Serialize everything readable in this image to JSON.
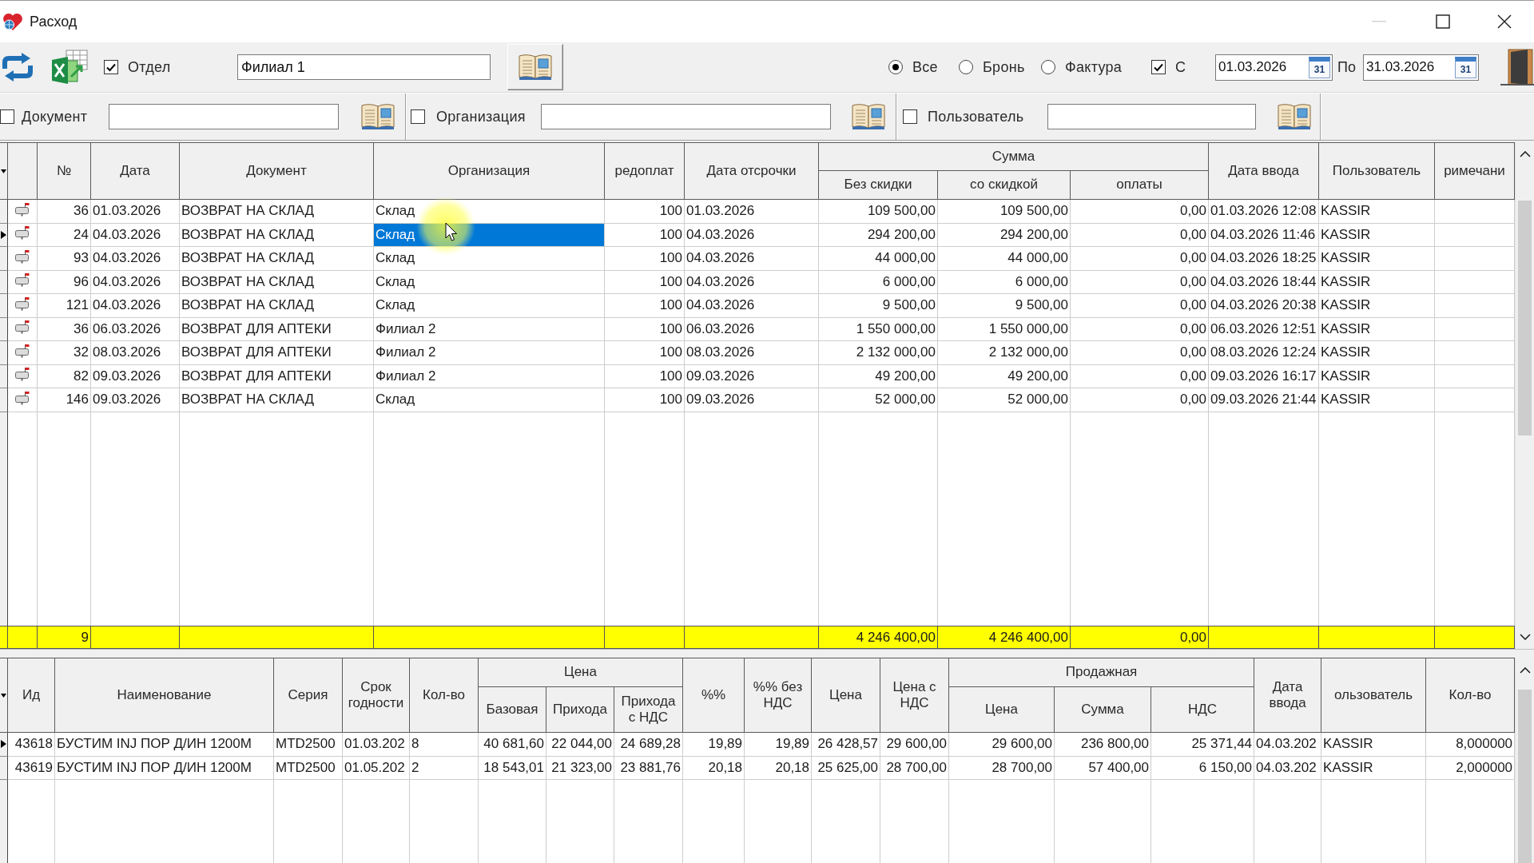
{
  "window": {
    "title": "Расход",
    "controls": [
      {
        "kind": "minimize",
        "disabled": true
      },
      {
        "kind": "maximize",
        "disabled": false
      },
      {
        "kind": "close",
        "disabled": false
      }
    ]
  },
  "toolbar": {
    "department": {
      "label": "Отдел",
      "checked": true,
      "value": "Филиал 1"
    },
    "type_filter": [
      {
        "label": "Все",
        "selected": true
      },
      {
        "label": "Бронь",
        "selected": false
      },
      {
        "label": "Фактура",
        "selected": false
      }
    ],
    "period": {
      "label": "С",
      "checked": true,
      "from": "01.03.2026",
      "from_calendar": "31",
      "to_label": "По",
      "to": "31.03.2026",
      "to_calendar": "31"
    }
  },
  "filters": [
    {
      "label": "Документ",
      "checked": false
    },
    {
      "label": "Организация",
      "checked": false
    },
    {
      "label": "Пользователь",
      "checked": false
    }
  ],
  "main_grid": {
    "columns": [
      {
        "label": "№"
      },
      {
        "label": "Дата"
      },
      {
        "label": "Документ"
      },
      {
        "label": "Организация"
      },
      {
        "label": "редоплат"
      },
      {
        "label": "Дата отсрочки"
      },
      {
        "label": "Сумма",
        "colspan": 3,
        "children": [
          {
            "label": "Без скидки"
          },
          {
            "label": "со скидкой"
          },
          {
            "label": "оплаты"
          }
        ]
      },
      {
        "label": "Дата ввода"
      },
      {
        "label": "Пользователь"
      },
      {
        "label": "римечани"
      }
    ],
    "rows": [
      {
        "selected": false,
        "cells": [
          "36",
          "01.03.2026",
          "ВОЗВРАТ НА СКЛАД",
          "Склад",
          "100",
          "01.03.2026",
          "109 500,00",
          "109 500,00",
          "0,00",
          "01.03.2026 12:08",
          "KASSIR"
        ]
      },
      {
        "selected": true,
        "cells": [
          "24",
          "04.03.2026",
          "ВОЗВРАТ НА СКЛАД",
          "Склад",
          "100",
          "04.03.2026",
          "294 200,00",
          "294 200,00",
          "0,00",
          "04.03.2026 11:46",
          "KASSIR"
        ]
      },
      {
        "selected": false,
        "cells": [
          "93",
          "04.03.2026",
          "ВОЗВРАТ НА СКЛАД",
          "Склад",
          "100",
          "04.03.2026",
          "44 000,00",
          "44 000,00",
          "0,00",
          "04.03.2026 18:25",
          "KASSIR"
        ]
      },
      {
        "selected": false,
        "cells": [
          "96",
          "04.03.2026",
          "ВОЗВРАТ НА СКЛАД",
          "Склад",
          "100",
          "04.03.2026",
          "6 000,00",
          "6 000,00",
          "0,00",
          "04.03.2026 18:44",
          "KASSIR"
        ]
      },
      {
        "selected": false,
        "cells": [
          "121",
          "04.03.2026",
          "ВОЗВРАТ НА СКЛАД",
          "Склад",
          "100",
          "04.03.2026",
          "9 500,00",
          "9 500,00",
          "0,00",
          "04.03.2026 20:38",
          "KASSIR"
        ]
      },
      {
        "selected": false,
        "cells": [
          "36",
          "06.03.2026",
          "ВОЗВРАТ ДЛЯ АПТЕКИ",
          "Филиал 2",
          "100",
          "06.03.2026",
          "1 550 000,00",
          "1 550 000,00",
          "0,00",
          "06.03.2026 12:51",
          "KASSIR"
        ]
      },
      {
        "selected": false,
        "cells": [
          "32",
          "08.03.2026",
          "ВОЗВРАТ ДЛЯ АПТЕКИ",
          "Филиал 2",
          "100",
          "08.03.2026",
          "2 132 000,00",
          "2 132 000,00",
          "0,00",
          "08.03.2026 12:24",
          "KASSIR"
        ]
      },
      {
        "selected": false,
        "cells": [
          "82",
          "09.03.2026",
          "ВОЗВРАТ ДЛЯ АПТЕКИ",
          "Филиал 2",
          "100",
          "09.03.2026",
          "49 200,00",
          "49 200,00",
          "0,00",
          "09.03.2026 16:17",
          "KASSIR"
        ]
      },
      {
        "selected": false,
        "cells": [
          "146",
          "09.03.2026",
          "ВОЗВРАТ НА СКЛАД",
          "Склад",
          "100",
          "09.03.2026",
          "52 000,00",
          "52 000,00",
          "0,00",
          "09.03.2026 21:44",
          "KASSIR"
        ]
      }
    ],
    "totals": {
      "count": "9",
      "without_discount": "4 246 400,00",
      "with_discount": "4 246 400,00",
      "paid": "0,00"
    }
  },
  "detail_grid": {
    "columns": [
      {
        "label": "Ид"
      },
      {
        "label": "Наименование"
      },
      {
        "label": "Серия"
      },
      {
        "label": "Срок годности"
      },
      {
        "label": "Кол-во"
      },
      {
        "label": "Цена",
        "colspan": 3,
        "children": [
          {
            "label": "Базовая"
          },
          {
            "label": "Прихода"
          },
          {
            "label": "Прихода с НДС"
          }
        ]
      },
      {
        "label": "%%"
      },
      {
        "label": "%% без НДС"
      },
      {
        "label": "Цена"
      },
      {
        "label": "Цена с НДС"
      },
      {
        "label": "Продажная",
        "colspan": 3,
        "children": [
          {
            "label": "Цена"
          },
          {
            "label": "Сумма"
          },
          {
            "label": "НДС"
          }
        ]
      },
      {
        "label": "Дата ввода"
      },
      {
        "label": "ользователь"
      },
      {
        "label": "Кол-во"
      }
    ],
    "rows": [
      {
        "selected": true,
        "cells": [
          "43618",
          "БУСТИМ INJ ПОР Д/ИН 1200М",
          "MTD2500",
          "01.03.202",
          "8",
          "40 681,60",
          "22 044,00",
          "24 689,28",
          "19,89",
          "19,89",
          "26 428,57",
          "29 600,00",
          "29 600,00",
          "236 800,00",
          "25 371,44",
          "04.03.202",
          "KASSIR",
          "8,000000"
        ]
      },
      {
        "selected": false,
        "cells": [
          "43619",
          "БУСТИМ INJ ПОР Д/ИН 1200М",
          "MTD2500",
          "01.05.202",
          "2",
          "18 543,01",
          "21 323,00",
          "23 881,76",
          "20,18",
          "20,18",
          "25 625,00",
          "28 700,00",
          "28 700,00",
          "57 400,00",
          "6 150,00",
          "04.03.202",
          "KASSIR",
          "2,000000"
        ]
      }
    ]
  }
}
